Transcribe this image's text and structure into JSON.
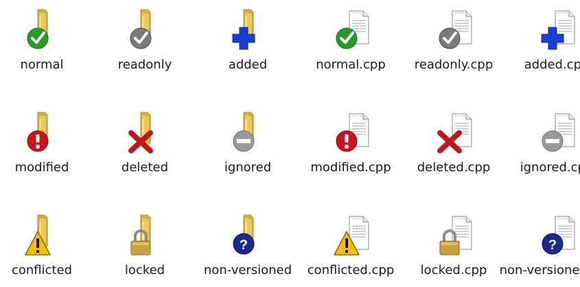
{
  "items": [
    {
      "label": "normal",
      "kind": "folder",
      "overlay": "normal-check"
    },
    {
      "label": "readonly",
      "kind": "folder",
      "overlay": "readonly-check"
    },
    {
      "label": "added",
      "kind": "folder",
      "overlay": "added-plus"
    },
    {
      "label": "normal.cpp",
      "kind": "file",
      "overlay": "normal-check"
    },
    {
      "label": "readonly.cpp",
      "kind": "file",
      "overlay": "readonly-check"
    },
    {
      "label": "added.cpp",
      "kind": "file",
      "overlay": "added-plus"
    },
    {
      "label": "modified",
      "kind": "folder",
      "overlay": "modified-exclamation"
    },
    {
      "label": "deleted",
      "kind": "folder",
      "overlay": "deleted-cross"
    },
    {
      "label": "ignored",
      "kind": "folder",
      "overlay": "ignored-minus"
    },
    {
      "label": "modified.cpp",
      "kind": "file",
      "overlay": "modified-exclamation"
    },
    {
      "label": "deleted.cpp",
      "kind": "file",
      "overlay": "deleted-cross"
    },
    {
      "label": "ignored.cpp",
      "kind": "file",
      "overlay": "ignored-minus"
    },
    {
      "label": "conflicted",
      "kind": "folder",
      "overlay": "conflicted-warning"
    },
    {
      "label": "locked",
      "kind": "folder",
      "overlay": "locked-padlock"
    },
    {
      "label": "non-versioned",
      "kind": "folder",
      "overlay": "nonversioned-question"
    },
    {
      "label": "conflicted.cpp",
      "kind": "file",
      "overlay": "conflicted-warning"
    },
    {
      "label": "locked.cpp",
      "kind": "file",
      "overlay": "locked-padlock"
    },
    {
      "label": "non-versioned.cpp",
      "kind": "file",
      "overlay": "nonversioned-question"
    }
  ],
  "colors": {
    "normal": "#2a9a2a",
    "readonly": "#7a7a7a",
    "added": "#1a3fd0",
    "modified": "#c8141e",
    "deleted": "#c01818",
    "ignored": "#9a9a9a",
    "conflicted": "#f5c000",
    "locked": "#c8a040",
    "nonversioned": "#1a2a8a",
    "folder": "#ecc85a",
    "file": "#ffffff"
  }
}
